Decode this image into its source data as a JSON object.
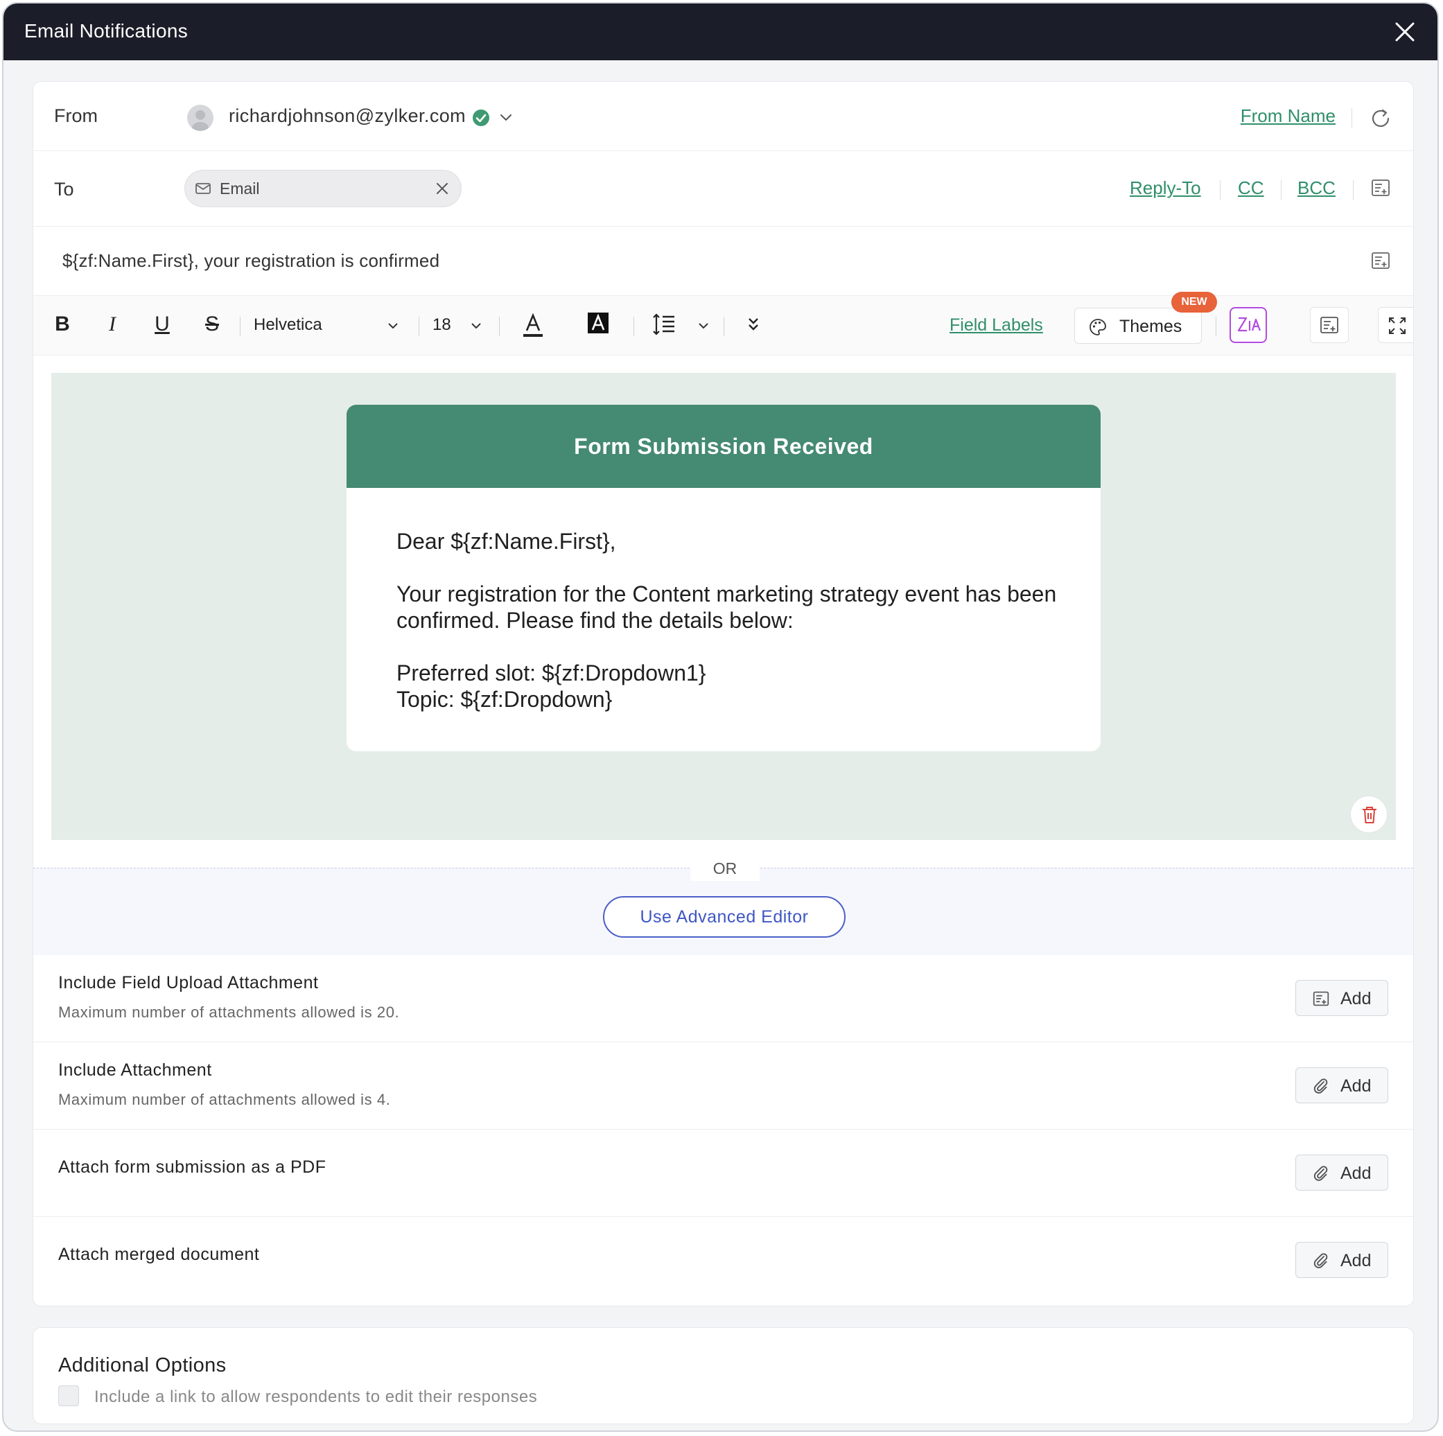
{
  "window": {
    "title": "Email Notifications"
  },
  "from": {
    "label": "From",
    "email": "richardjohnson@zylker.com",
    "from_name_link": "From Name"
  },
  "to": {
    "label": "To",
    "chip_label": "Email",
    "links": {
      "reply_to": "Reply-To",
      "cc": "CC",
      "bcc": "BCC"
    }
  },
  "subject": {
    "value": "${zf:Name.First}, your registration is confirmed"
  },
  "toolbar": {
    "font": "Helvetica",
    "size": "18",
    "field_labels_link": "Field Labels",
    "themes_label": "Themes",
    "new_badge": "NEW"
  },
  "email_preview": {
    "header": "Form Submission Received",
    "greeting": "Dear ${zf:Name.First},",
    "paragraph": "Your registration for the Content marketing strategy event has been confirmed. Please find the details below:",
    "line1": "Preferred slot: ${zf:Dropdown1}",
    "line2": "Topic: ${zf:Dropdown}",
    "header_color": "#458a72",
    "background_color": "#e5ede8"
  },
  "divider": {
    "or": "OR"
  },
  "advanced_editor_button": "Use Advanced Editor",
  "attachments": [
    {
      "title": "Include Field Upload Attachment",
      "subtitle": "Maximum number of attachments allowed is 20.",
      "button": "Add",
      "icon": "insert-field-icon"
    },
    {
      "title": "Include Attachment",
      "subtitle": "Maximum number of attachments allowed is 4.",
      "button": "Add",
      "icon": "paperclip-icon"
    },
    {
      "title": "Attach form submission as a PDF",
      "subtitle": "",
      "button": "Add",
      "icon": "paperclip-icon"
    },
    {
      "title": "Attach merged document",
      "subtitle": "",
      "button": "Add",
      "icon": "paperclip-icon"
    }
  ],
  "additional_options": {
    "title": "Additional Options",
    "checkbox_label": "Include a link to allow respondents to edit their responses",
    "checked": false
  },
  "colors": {
    "link": "#2f8f6a",
    "title_bar": "#1b1e29",
    "accent_blue": "#3e56c4",
    "badge": "#e8623a",
    "zia": "#b44be0"
  }
}
